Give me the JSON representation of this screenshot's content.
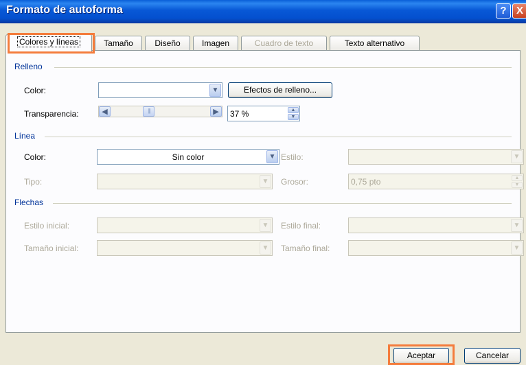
{
  "window": {
    "title": "Formato de autoforma",
    "help_icon": "?",
    "close_icon": "X"
  },
  "tabs": [
    {
      "label": "Colores y líneas",
      "state": "active"
    },
    {
      "label": "Tamaño",
      "state": "normal"
    },
    {
      "label": "Diseño",
      "state": "normal"
    },
    {
      "label": "Imagen",
      "state": "normal"
    },
    {
      "label": "Cuadro de texto",
      "state": "disabled"
    },
    {
      "label": "Texto alternativo",
      "state": "normal"
    }
  ],
  "fill": {
    "section_label": "Relleno",
    "color_label": "Color:",
    "color_value": "",
    "effects_button": "Efectos de relleno...",
    "transparency_label": "Transparencia:",
    "transparency_value": "37 %",
    "transparency_fraction": 0.37
  },
  "line": {
    "section_label": "Línea",
    "color_label": "Color:",
    "color_value": "Sin color",
    "style_label": "Estilo:",
    "style_value": "",
    "type_label": "Tipo:",
    "type_value": "",
    "weight_label": "Grosor:",
    "weight_value": "0,75 pto"
  },
  "arrows": {
    "section_label": "Flechas",
    "begin_style_label": "Estilo inicial:",
    "end_style_label": "Estilo final:",
    "begin_size_label": "Tamaño inicial:",
    "end_size_label": "Tamaño final:"
  },
  "footer": {
    "ok_button": "Aceptar",
    "cancel_button": "Cancelar"
  },
  "colors": {
    "titlebar": "#0858d6",
    "section_text": "#003399",
    "highlight": "#f47c3c"
  }
}
